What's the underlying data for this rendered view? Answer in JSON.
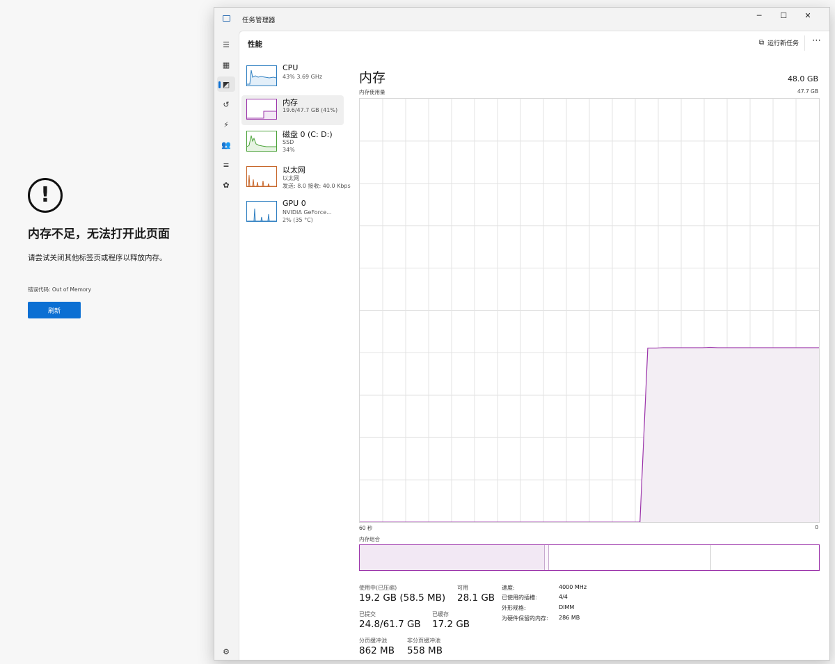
{
  "error_page": {
    "icon": "exclamation-circle-icon",
    "title": "内存不足，无法打开此页面",
    "description": "请尝试关闭其他标签页或程序以释放内存。",
    "error_code": "错误代码: Out of Memory",
    "refresh_label": "刷新"
  },
  "window": {
    "app_title": "任务管理器",
    "minimize": "─",
    "maximize": "☐",
    "close": "✕"
  },
  "header": {
    "title": "性能",
    "run_new_task": "运行新任务",
    "more": "⋯"
  },
  "sidebar": [
    {
      "name": "hamburger-menu-icon",
      "glyph": "☰"
    },
    {
      "name": "processes-icon",
      "glyph": "▦"
    },
    {
      "name": "performance-icon",
      "glyph": "◩"
    },
    {
      "name": "app-history-icon",
      "glyph": "↺"
    },
    {
      "name": "startup-apps-icon",
      "glyph": "⚡"
    },
    {
      "name": "users-icon",
      "glyph": "👥"
    },
    {
      "name": "details-icon",
      "glyph": "≡"
    },
    {
      "name": "services-icon",
      "glyph": "✿"
    },
    {
      "name": "settings-icon",
      "glyph": "⚙"
    }
  ],
  "devices": [
    {
      "name": "CPU",
      "line1": "43% 3.69 GHz",
      "line2": ""
    },
    {
      "name": "内存",
      "line1": "19.6/47.7 GB (41%)",
      "line2": ""
    },
    {
      "name": "磁盘 0 (C: D:)",
      "line1": "SSD",
      "line2": "34%"
    },
    {
      "name": "以太网",
      "line1": "以太网",
      "line2": "发送: 8.0 接收: 40.0 Kbps"
    },
    {
      "name": "GPU 0",
      "line1": "NVIDIA GeForce...",
      "line2": "2% (35 °C)"
    }
  ],
  "memory": {
    "title": "内存",
    "capacity": "48.0 GB",
    "usage_label": "内存使用量",
    "max_label": "47.7 GB",
    "time_left": "60 秒",
    "time_right": "0",
    "composition_label": "内存组合",
    "stats": {
      "in_use_label": "使用中(已压缩)",
      "in_use_value": "19.2 GB (58.5 MB)",
      "available_label": "可用",
      "available_value": "28.1 GB",
      "committed_label": "已提交",
      "committed_value": "24.8/61.7 GB",
      "cached_label": "已缓存",
      "cached_value": "17.2 GB",
      "paged_pool_label": "分页缓冲池",
      "paged_pool_value": "862 MB",
      "nonpaged_pool_label": "非分页缓冲池",
      "nonpaged_pool_value": "558 MB"
    },
    "specs": [
      {
        "label": "速度:",
        "value": "4000 MHz"
      },
      {
        "label": "已使用的插槽:",
        "value": "4/4"
      },
      {
        "label": "外形规格:",
        "value": "DIMM"
      },
      {
        "label": "为硬件保留的内存:",
        "value": "286 MB"
      }
    ],
    "graph_color": "#9b33aa",
    "graph_fill": "#f3eef4",
    "usage_history_fraction": [
      0,
      0,
      0,
      0,
      0,
      0,
      0,
      0,
      0,
      0,
      0,
      0,
      0,
      0,
      0,
      0,
      0,
      0,
      0,
      0,
      0,
      0,
      0,
      0,
      0,
      0,
      0,
      0,
      0,
      0,
      0,
      0,
      0,
      0,
      0,
      0,
      0,
      0.411,
      0.411,
      0.412,
      0.412,
      0.412,
      0.412,
      0.412,
      0.412,
      0.413,
      0.412,
      0.412,
      0.412,
      0.412,
      0.412,
      0.412,
      0.412,
      0.412,
      0.412,
      0.412,
      0.412,
      0.412,
      0.412,
      0.412
    ],
    "composition": {
      "in_use_fraction": 0.4,
      "modified_fraction": 0.01,
      "standby_fraction": 0.36
    }
  },
  "colors": {
    "accent": "#0b6fd3",
    "cpu": "#2f7fc1",
    "memory": "#9b33aa",
    "disk": "#4da33b",
    "ethernet": "#c7672b",
    "gpu": "#2f7fc1"
  }
}
